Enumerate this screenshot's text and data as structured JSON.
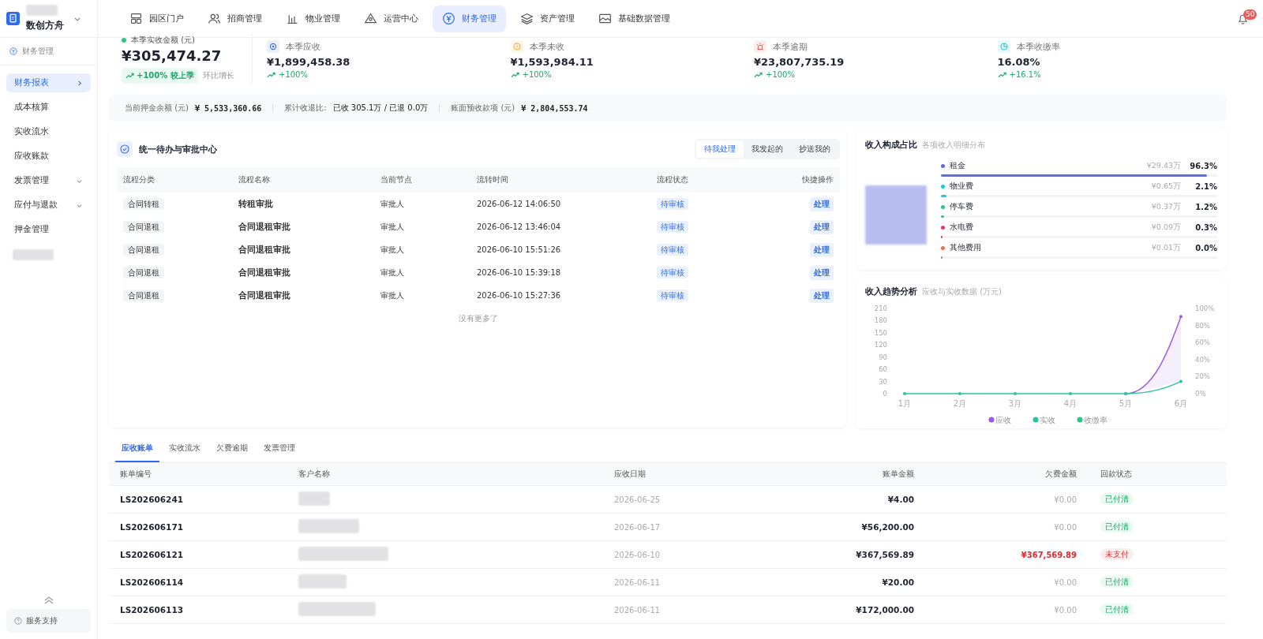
{
  "brand": {
    "name": "数创方舟"
  },
  "nav": [
    {
      "label": "园区门户",
      "selected": false
    },
    {
      "label": "招商管理",
      "selected": false
    },
    {
      "label": "物业管理",
      "selected": false
    },
    {
      "label": "运营中心",
      "selected": false
    },
    {
      "label": "财务管理",
      "selected": true
    },
    {
      "label": "资产管理",
      "selected": false
    },
    {
      "label": "基础数据管理",
      "selected": false
    }
  ],
  "notifications": {
    "count": "50"
  },
  "sidebar": {
    "header": "财务管理",
    "items": [
      {
        "label": "财务报表",
        "selected": true,
        "kind": "link"
      },
      {
        "label": "成本核算",
        "selected": false,
        "kind": "plain"
      },
      {
        "label": "实收流水",
        "selected": false,
        "kind": "plain"
      },
      {
        "label": "应收账款",
        "selected": false,
        "kind": "plain"
      },
      {
        "label": "发票管理",
        "selected": false,
        "kind": "group"
      },
      {
        "label": "应付与退款",
        "selected": false,
        "kind": "group"
      },
      {
        "label": "押金管理",
        "selected": false,
        "kind": "plain"
      }
    ],
    "support": "服务支持"
  },
  "stats": {
    "main": {
      "label": "本季实收金额 (元)",
      "value": "¥305,474.27",
      "change": "+100% 较上季",
      "note": "环比增长"
    },
    "cards": [
      {
        "label": "本季应收",
        "value": "¥1,899,458.38",
        "change": "+100%"
      },
      {
        "label": "本季未收",
        "value": "¥1,593,984.11",
        "change": "+100%"
      },
      {
        "label": "本季逾期",
        "value": "¥23,807,735.19",
        "change": "+100%"
      },
      {
        "label": "本季收缴率",
        "value": "16.08%",
        "change": "+16.1%"
      }
    ]
  },
  "summary": [
    {
      "label": "当前押金余额 (元)",
      "value": "¥ 5,533,360.66",
      "kind": "mono"
    },
    {
      "label": "累计收退比:",
      "value": "已收 305.1万 / 已退 0.0万",
      "kind": "plain"
    },
    {
      "label": "账面预收款项 (元)",
      "value": "¥ 2,804,553.74",
      "kind": "mono"
    }
  ],
  "approvals": {
    "title": "统一待办与审批中心",
    "tabs": [
      {
        "label": "待我处理",
        "selected": true
      },
      {
        "label": "我发起的",
        "selected": false
      },
      {
        "label": "抄送我的",
        "selected": false
      }
    ],
    "columns": [
      "流程分类",
      "流程名称",
      "当前节点",
      "流转时间",
      "流程状态",
      "快捷操作"
    ],
    "rows": [
      {
        "category": "合同转租",
        "name": "转租审批",
        "node": "审批人",
        "time": "2026-06-12 14:06:50",
        "status": "待审核",
        "action": "处理"
      },
      {
        "category": "合同退租",
        "name": "合同退租审批",
        "node": "审批人",
        "time": "2026-06-12 13:46:04",
        "status": "待审核",
        "action": "处理"
      },
      {
        "category": "合同退租",
        "name": "合同退租审批",
        "node": "审批人",
        "time": "2026-06-10 15:51:26",
        "status": "待审核",
        "action": "处理"
      },
      {
        "category": "合同退租",
        "name": "合同退租审批",
        "node": "审批人",
        "time": "2026-06-10 15:39:18",
        "status": "待审核",
        "action": "处理"
      },
      {
        "category": "合同退租",
        "name": "合同退租审批",
        "node": "审批人",
        "time": "2026-06-10 15:27:36",
        "status": "待审核",
        "action": "处理"
      }
    ],
    "footer": "没有更多了"
  },
  "composition": {
    "title": "收入构成占比",
    "subtitle": "各项收入明细分布",
    "items": [
      {
        "name": "租金",
        "color": "#5b6ee1",
        "amount": "¥29.43万",
        "pct": "96.3%",
        "level": 0.963
      },
      {
        "name": "物业费",
        "color": "#22c7d9",
        "amount": "¥0.65万",
        "pct": "2.1%",
        "level": 0.021
      },
      {
        "name": "停车费",
        "color": "#2cc486",
        "amount": "¥0.37万",
        "pct": "1.2%",
        "level": 0.012
      },
      {
        "name": "水电费",
        "color": "#e83a5e",
        "amount": "¥0.09万",
        "pct": "0.3%",
        "level": 0.003
      },
      {
        "name": "其他费用",
        "color": "#f07048",
        "amount": "¥0.01万",
        "pct": "0.0%",
        "level": 0.0
      }
    ]
  },
  "trend": {
    "title": "收入趋势分析",
    "subtitle": "应收与实收数据 (万元)",
    "chart_data": {
      "type": "line",
      "categories": [
        "1月",
        "2月",
        "3月",
        "4月",
        "5月",
        "6月"
      ],
      "series": [
        {
          "name": "应收",
          "color": "#9b59e8",
          "values": [
            null,
            null,
            null,
            null,
            0,
            190
          ]
        },
        {
          "name": "实收",
          "color": "#2cc4a0",
          "values": [
            0,
            0,
            0,
            0,
            0,
            30
          ]
        }
      ],
      "legend": "bottom",
      "ylim": [
        0,
        210
      ],
      "yticks": [
        0,
        30,
        60,
        90,
        120,
        150,
        180,
        210
      ],
      "y2lim": [
        0,
        100
      ],
      "y2ticks": [
        {
          "value": 0,
          "label": "0%"
        },
        {
          "value": 20,
          "label": "20%"
        },
        {
          "value": 40,
          "label": "40%"
        },
        {
          "value": 60,
          "label": "60%"
        },
        {
          "value": 80,
          "label": "80%"
        },
        {
          "value": 100,
          "label": "100%"
        }
      ]
    },
    "extra_legend": {
      "name": "收缴率",
      "color": "#2cc486"
    }
  },
  "bills": {
    "tabs": [
      {
        "label": "应收账单",
        "selected": true
      },
      {
        "label": "实收流水",
        "selected": false
      },
      {
        "label": "欠费逾期",
        "selected": false
      },
      {
        "label": "发票管理",
        "selected": false
      }
    ],
    "columns": [
      "账单编号",
      "客户名称",
      "应收日期",
      "账单金额",
      "欠费金额",
      "回款状态"
    ],
    "rows": [
      {
        "no": "LS202606241",
        "date": "2026-06-25",
        "amount": "¥4.00",
        "arrears": "¥0.00",
        "status": "已付清",
        "kind": "paid"
      },
      {
        "no": "LS202606171",
        "date": "2026-06-17",
        "amount": "¥56,200.00",
        "arrears": "¥0.00",
        "status": "已付清",
        "kind": "paid"
      },
      {
        "no": "LS202606121",
        "date": "2026-06-10",
        "amount": "¥367,569.89",
        "arrears": "¥367,569.89",
        "status": "未支付",
        "kind": "unpaid"
      },
      {
        "no": "LS202606114",
        "date": "2026-06-11",
        "amount": "¥20.00",
        "arrears": "¥0.00",
        "status": "已付清",
        "kind": "paid"
      },
      {
        "no": "LS202606113",
        "date": "2026-06-11",
        "amount": "¥172,000.00",
        "arrears": "¥0.00",
        "status": "已付清",
        "kind": "paid"
      }
    ]
  }
}
